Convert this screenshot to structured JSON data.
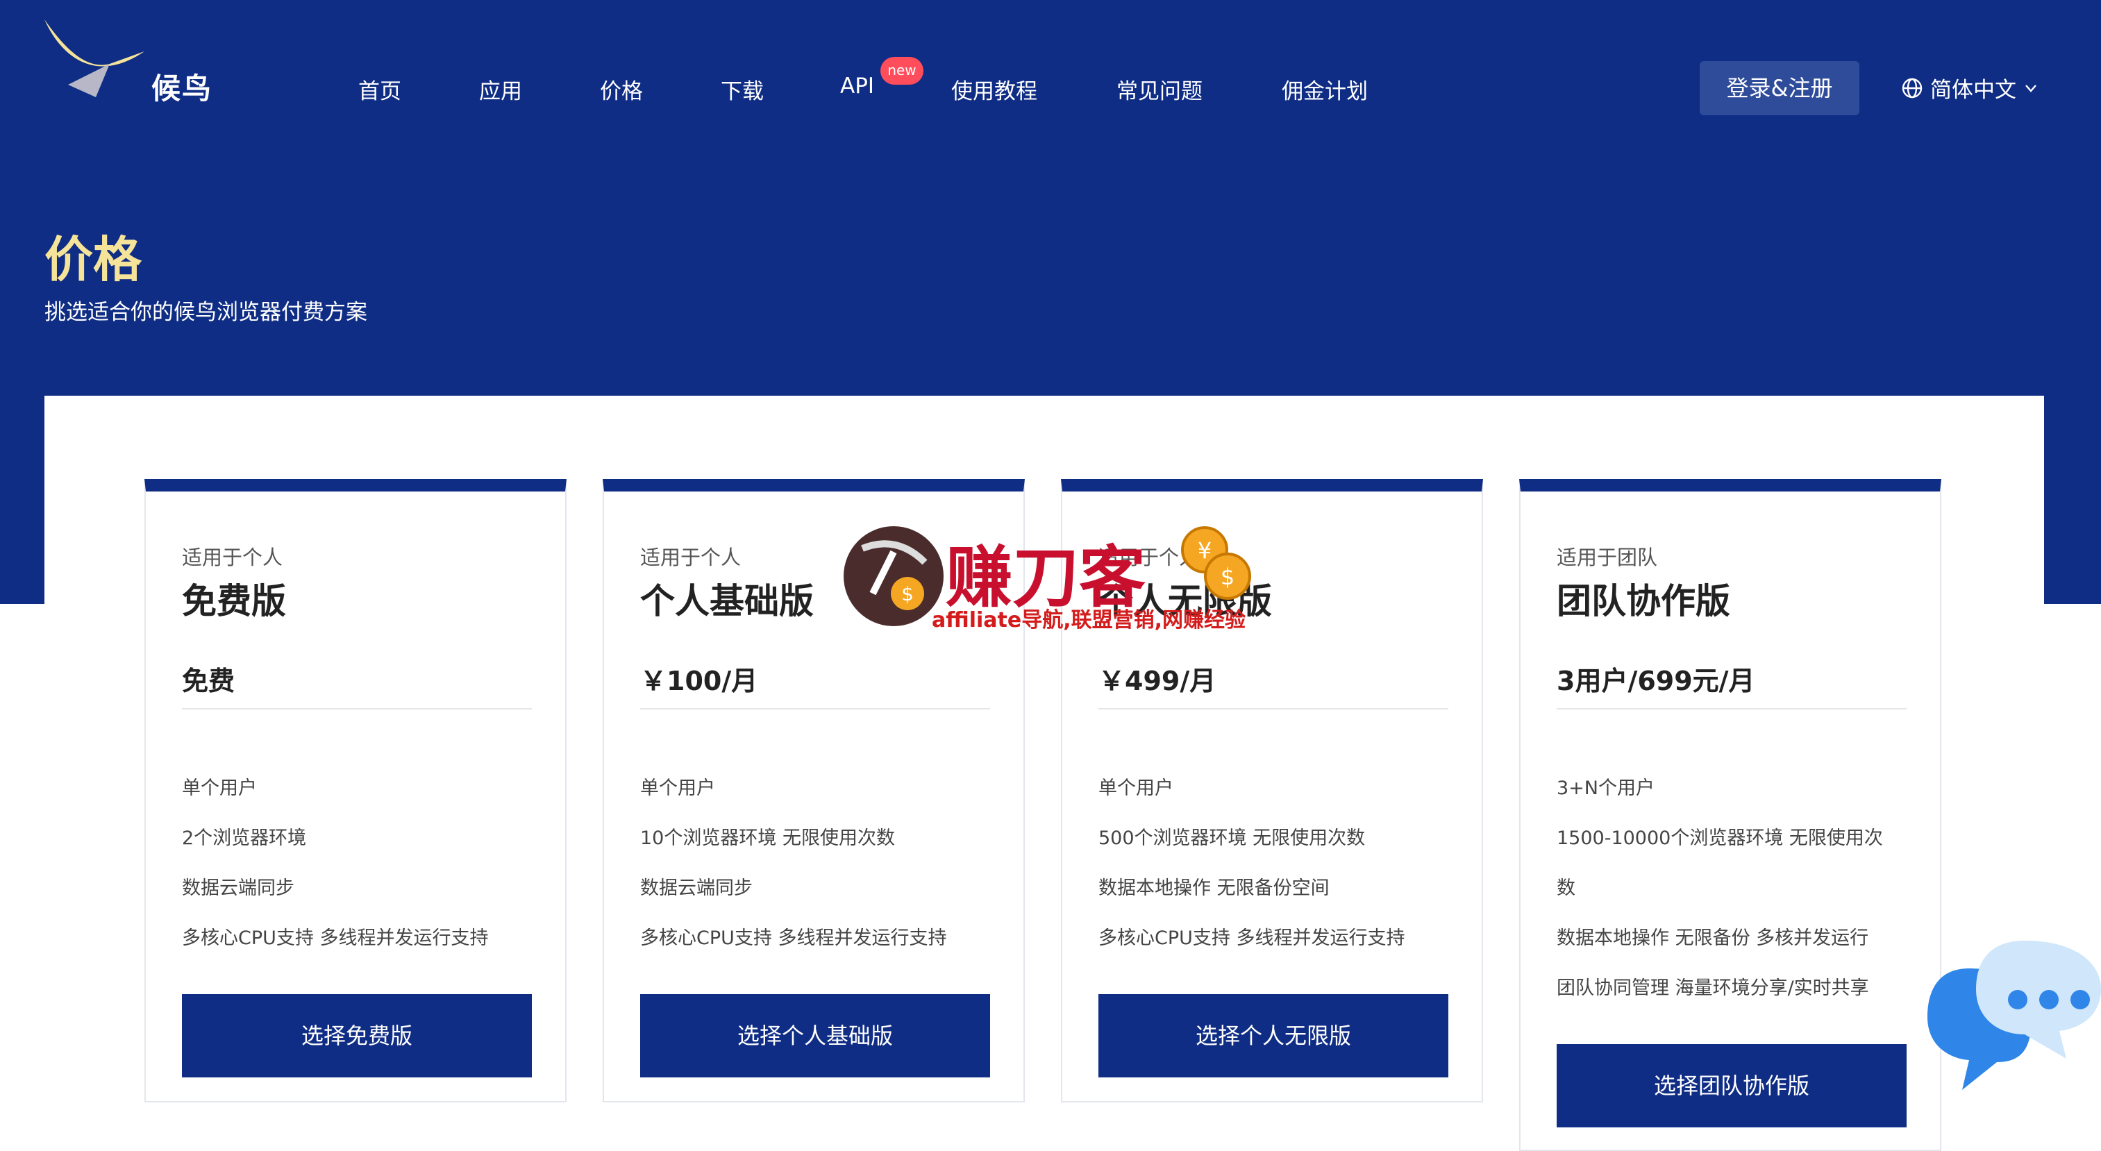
{
  "brand": {
    "name": "候鸟"
  },
  "nav": [
    {
      "label": "首页"
    },
    {
      "label": "应用"
    },
    {
      "label": "价格"
    },
    {
      "label": "下载"
    },
    {
      "label": "API",
      "badge": "new"
    },
    {
      "label": "使用教程"
    },
    {
      "label": "常见问题"
    },
    {
      "label": "佣金计划"
    }
  ],
  "header": {
    "login_label": "登录&注册",
    "language": "简体中文"
  },
  "page": {
    "title": "价格",
    "subtitle": "挑选适合你的候鸟浏览器付费方案"
  },
  "plans": [
    {
      "for": "适用于个人",
      "name": "免费版",
      "price": "免费",
      "features": [
        "单个用户",
        "2个浏览器环境",
        "数据云端同步",
        "多核心CPU支持 多线程并发运行支持"
      ],
      "button": "选择免费版"
    },
    {
      "for": "适用于个人",
      "name": "个人基础版",
      "price": "￥100/月",
      "features": [
        "单个用户",
        "10个浏览器环境 无限使用次数",
        "数据云端同步",
        "多核心CPU支持 多线程并发运行支持"
      ],
      "button": "选择个人基础版"
    },
    {
      "for": "适用于个人",
      "name": "个人无限版",
      "price": "￥499/月",
      "features": [
        "单个用户",
        "500个浏览器环境 无限使用次数",
        "数据本地操作 无限备份空间",
        "多核心CPU支持 多线程并发运行支持"
      ],
      "button": "选择个人无限版"
    },
    {
      "for": "适用于团队",
      "name": "团队协作版",
      "price": "3用户/699元/月",
      "features": [
        "3+N个用户",
        "1500-10000个浏览器环境 无限使用次",
        "数",
        "数据本地操作 无限备份 多核并发运行",
        "团队协同管理 海量环境分享/实时共享"
      ],
      "button": "选择团队协作版"
    }
  ],
  "watermark": {
    "title": "赚刀客",
    "caption": "affiliate导航,联盟营销,网赚经验"
  },
  "colors": {
    "primary": "#0f2d84",
    "title_accent": "#f5e39a",
    "badge": "#ff4d5b",
    "login_bg": "#2f4c9a"
  }
}
